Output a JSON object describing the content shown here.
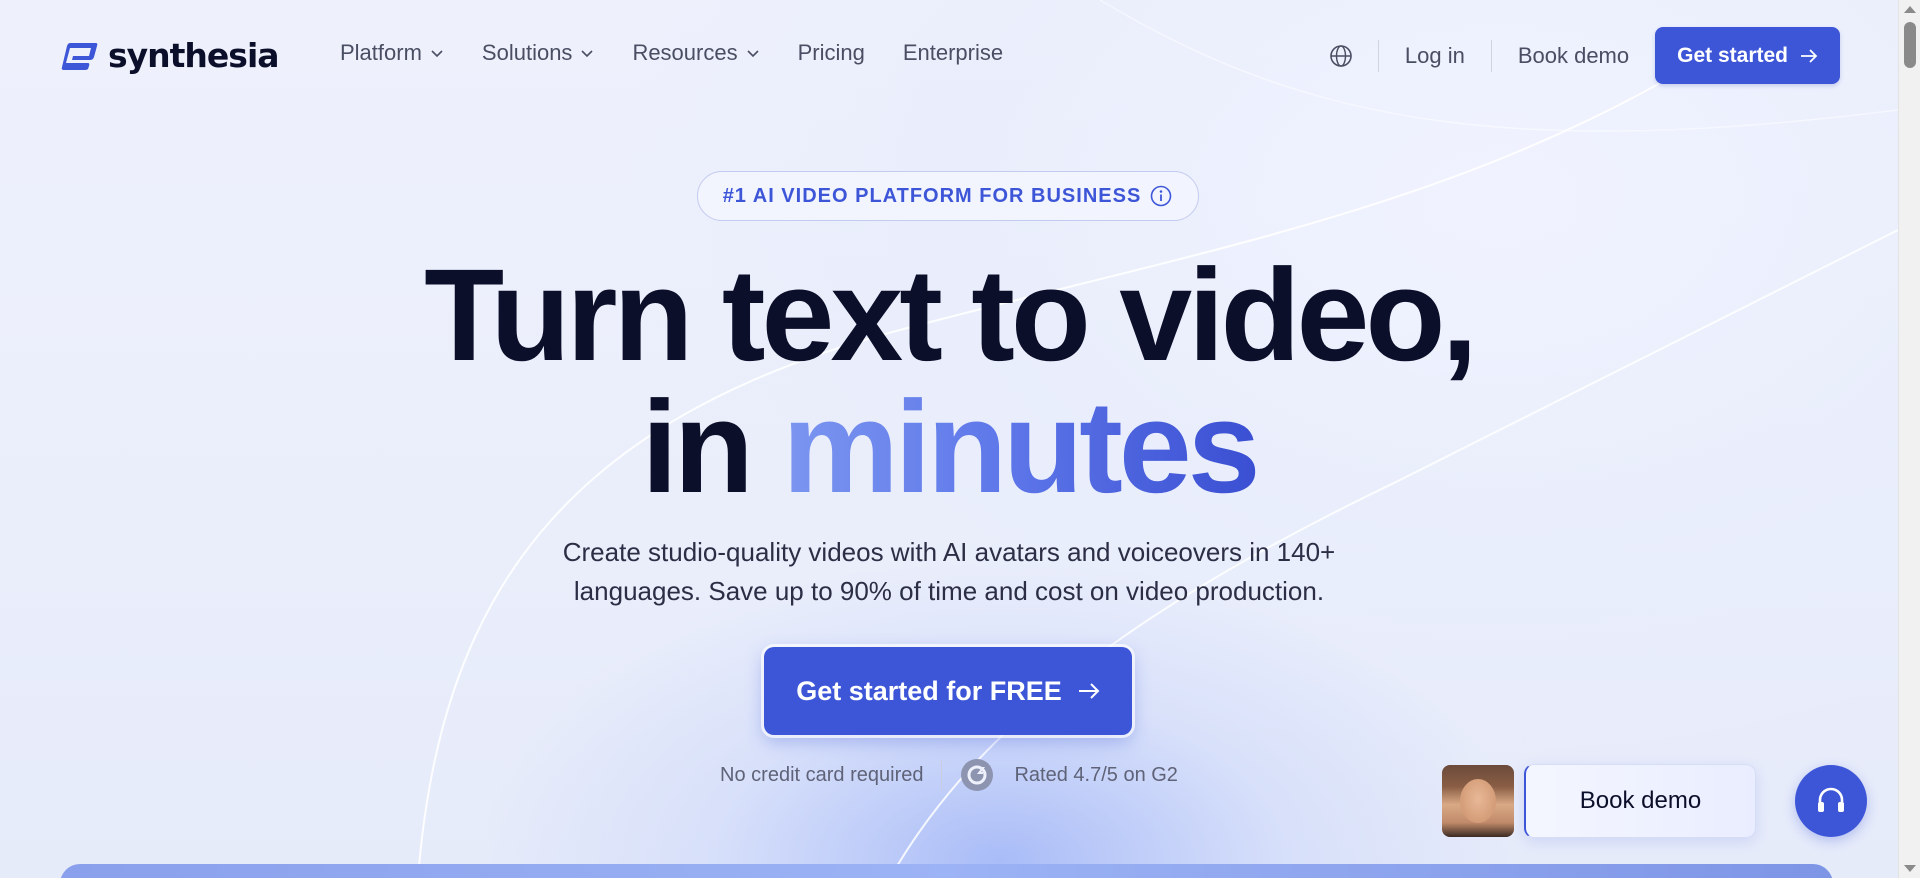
{
  "brand": {
    "name": "synthesia",
    "icon": "synthesia-logo-icon",
    "accent": "#3d56d8"
  },
  "nav": {
    "menu": [
      {
        "label": "Platform",
        "has_dropdown": true
      },
      {
        "label": "Solutions",
        "has_dropdown": true
      },
      {
        "label": "Resources",
        "has_dropdown": true
      },
      {
        "label": "Pricing",
        "has_dropdown": false
      },
      {
        "label": "Enterprise",
        "has_dropdown": false
      }
    ],
    "language_icon": "globe-icon",
    "login": "Log in",
    "book_demo": "Book demo",
    "get_started": "Get started"
  },
  "hero": {
    "badge": "#1 AI VIDEO PLATFORM FOR BUSINESS",
    "headline_line1": "Turn text to video,",
    "headline_line2_prefix": "in",
    "headline_line2_highlight": "minutes",
    "subtext_line1": "Create studio-quality videos with AI avatars and voiceovers in 140+",
    "subtext_line2": "languages. Save up to 90% of time and cost on video production.",
    "cta": "Get started for FREE",
    "no_credit_card": "No credit card required",
    "rating": "Rated 4.7/5 on G2"
  },
  "floating": {
    "book_demo": "Book demo",
    "support_icon": "headset-icon"
  }
}
